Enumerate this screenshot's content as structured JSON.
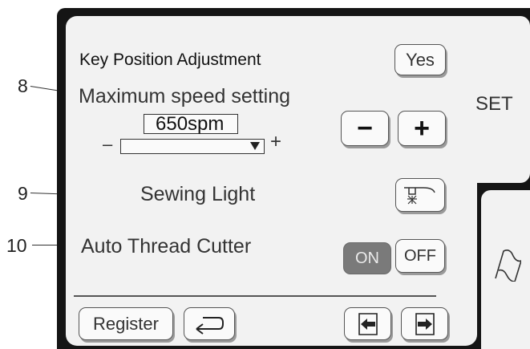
{
  "callouts": [
    "8",
    "9",
    "10"
  ],
  "panel": {
    "key_position_title": "Key Position Adjustment",
    "yes_label": "Yes",
    "max_speed_label": "Maximum speed setting",
    "speed_value": "650spm",
    "slider_minus": "–",
    "slider_plus": "+",
    "minus_label": "−",
    "plus_label": "+",
    "sewing_light_label": "Sewing Light",
    "auto_thread_cutter_label": "Auto Thread Cutter",
    "on_label": "ON",
    "off_label": "OFF",
    "register_label": "Register"
  },
  "sidebar": {
    "set_label": "SET"
  },
  "state": {
    "auto_thread_cutter": "ON"
  },
  "icons": [
    "dropdown-arrow-icon",
    "sewing-light-icon",
    "return-icon",
    "page-prev-icon",
    "page-next-icon",
    "flag-icon"
  ]
}
